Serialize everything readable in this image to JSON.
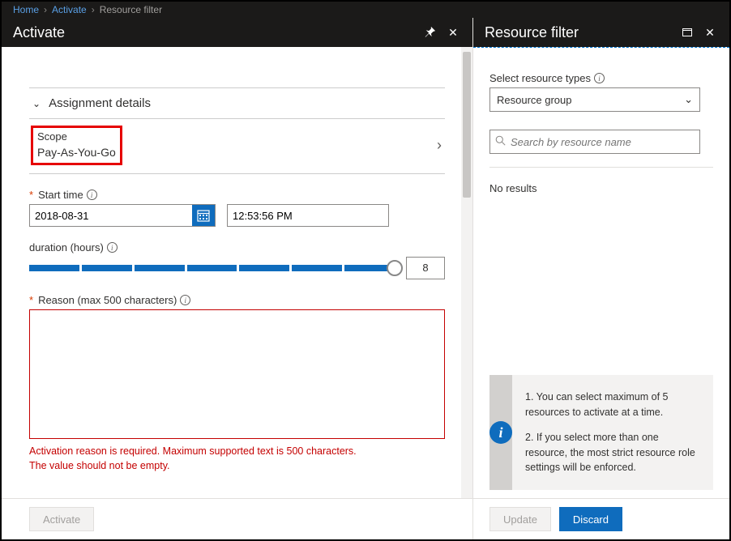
{
  "breadcrumb": {
    "home": "Home",
    "activate": "Activate",
    "resource_filter": "Resource filter"
  },
  "left": {
    "title": "Activate",
    "section": "Assignment details",
    "scope_label": "Scope",
    "scope_value": "Pay-As-You-Go",
    "start_time_label": "Start time",
    "date_value": "2018-08-31",
    "time_value": "12:53:56 PM",
    "duration_label": "duration (hours)",
    "duration_value": "8",
    "reason_label": "Reason (max 500 characters)",
    "reason_value": "",
    "error_line1": "Activation reason is required. Maximum supported text is 500 characters.",
    "error_line2": "The value should not be empty.",
    "activate_btn": "Activate"
  },
  "right": {
    "title": "Resource filter",
    "select_label": "Select resource types",
    "select_value": "Resource group",
    "search_placeholder": "Search by resource name",
    "no_results": "No results",
    "tip1": "1. You can select maximum of 5 resources to activate at a time.",
    "tip2": "2. If you select more than one resource, the most strict resource role settings will be enforced.",
    "update_btn": "Update",
    "discard_btn": "Discard"
  }
}
